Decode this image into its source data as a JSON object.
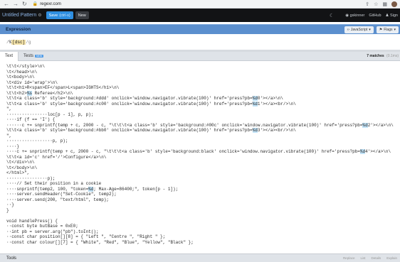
{
  "browser": {
    "url": "regexr.com",
    "icons": [
      "back-icon",
      "forward-icon",
      "reload-icon",
      "lock-icon",
      "share-icon",
      "star-icon",
      "extensions-icon"
    ]
  },
  "header": {
    "brand": "Untitled Pattern",
    "save_label": "Save",
    "save_shortcut": "(ctrl-s)",
    "new_label": "New",
    "user": "gskinner",
    "github": "GitHub",
    "sign": "Sign"
  },
  "expression": {
    "title": "Expression",
    "flavor": "JavaScript",
    "flags_label": "Flags",
    "open_slash": "/",
    "pattern_prefix": "%",
    "pattern_class": "[dsc]",
    "close_slash": "/",
    "flags": "g"
  },
  "tabs": {
    "text": "Text",
    "tests": "Tests",
    "tests_badge": "NEW",
    "matches": "7 matches",
    "time": "(0.1ms)"
  },
  "code_lines": [
    [
      {
        "t": "\\t\\t</style>\\n\\"
      }
    ],
    [
      {
        "t": "\\t</head>\\n\\"
      }
    ],
    [
      {
        "t": "\\t<body>\\n\\"
      }
    ],
    [
      {
        "t": "\\t<div id='wrap'>\\n\\"
      }
    ],
    [
      {
        "t": "\\t\\t<h1>R<span>EF</span>L<span>IGHTS</h1>\\n\\"
      }
    ],
    [
      {
        "t": "\\t\\t<h2>"
      },
      {
        "t": "%s",
        "m": 1
      },
      {
        "t": " Referee</h2>\\n\\"
      }
    ],
    [
      {
        "t": "\\t\\t<a class='b' style='background:#ddd' onclick='window.navigator.vibrate(100)' href='press?pb="
      },
      {
        "t": "%d",
        "m": 1
      },
      {
        "t": "0'></a>\\n\\"
      }
    ],
    [
      {
        "t": "\\t\\t<a class='b' style='background:#c00' onclick='window.navigator.vibrate(100)' href='press?pb="
      },
      {
        "t": "%d",
        "m": 1
      },
      {
        "t": "1'></a><br/>\\n\\"
      }
    ],
    [
      {
        "t": "\","
      }
    ],
    [
      {
        "t": "················loc[p - 1], p, p);"
      }
    ],
    [
      {
        "t": "····if (f == 'I') {"
      }
    ],
    [
      {
        "t": "······c += snprintf(temp + c, 2000 - c, \"\\t\\t\\t<a class='b' style='background:#00c' onclick='window.navigator.vibrate(100)' href='press?pb="
      },
      {
        "t": "%d",
        "m": 1
      },
      {
        "t": "2'></a>\\n\\"
      }
    ],
    [
      {
        "t": "\\t\\t<a class='b' style='background:#bb0' onclick='window.navigator.vibrate(100)' href='press?pb="
      },
      {
        "t": "%d",
        "m": 1
      },
      {
        "t": "3'></a><br/>\\n\\"
      }
    ],
    [
      {
        "t": "\","
      }
    ],
    [
      {
        "t": "··················p, p);"
      }
    ],
    [
      {
        "t": "····}"
      }
    ],
    [
      {
        "t": "····c += snprintf(temp + c, 2000 - c, \"\\t\\t\\t<a class='b' style='background:black' onclick='window.navigator.vibrate(100)' href='press?pb="
      },
      {
        "t": "%d",
        "m": 1
      },
      {
        "t": "4'></a>\\n\\"
      }
    ],
    [
      {
        "t": "\\t\\t<a id='c' href='/'>Configure</a>\\n\\"
      }
    ],
    [
      {
        "t": "\\t</div>\\n\\"
      }
    ],
    [
      {
        "t": "\\t</body>\\n\\"
      }
    ],
    [
      {
        "t": "</html>\","
      }
    ],
    [
      {
        "t": "················p);"
      }
    ],
    [
      {
        "t": "····// Set their position in a cookie"
      }
    ],
    [
      {
        "t": "····snprintf(temp2, 100, \"token="
      },
      {
        "t": "%d",
        "m": 1
      },
      {
        "t": "; Max-Age=86400;\", token[p - 1]);"
      }
    ],
    [
      {
        "t": "····server.sendHeader(\"Set-Cookie\", temp2);"
      }
    ],
    [
      {
        "t": "····server.send(200, \"text/html\", temp);"
      }
    ],
    [
      {
        "t": "··}"
      }
    ],
    [
      {
        "t": "}"
      }
    ],
    [
      {
        "t": ""
      }
    ],
    [
      {
        "t": "void handlePress() {"
      }
    ],
    [
      {
        "t": "··const byte butBase = 0xE0;"
      }
    ],
    [
      {
        "t": "··int pb = server.arg(\"pb\").toInt();"
      }
    ],
    [
      {
        "t": "··const char position[][8] = { \"Left \", \"Centre \", \"Right \" };"
      }
    ],
    [
      {
        "t": "··const char colour[][7] = { \"White\", \"Red\", \"Blue\", \"Yellow\", \"Black\" };"
      }
    ]
  ],
  "tools": {
    "title": "Tools",
    "items": [
      "Replace",
      "List",
      "Details",
      "Explain"
    ]
  }
}
